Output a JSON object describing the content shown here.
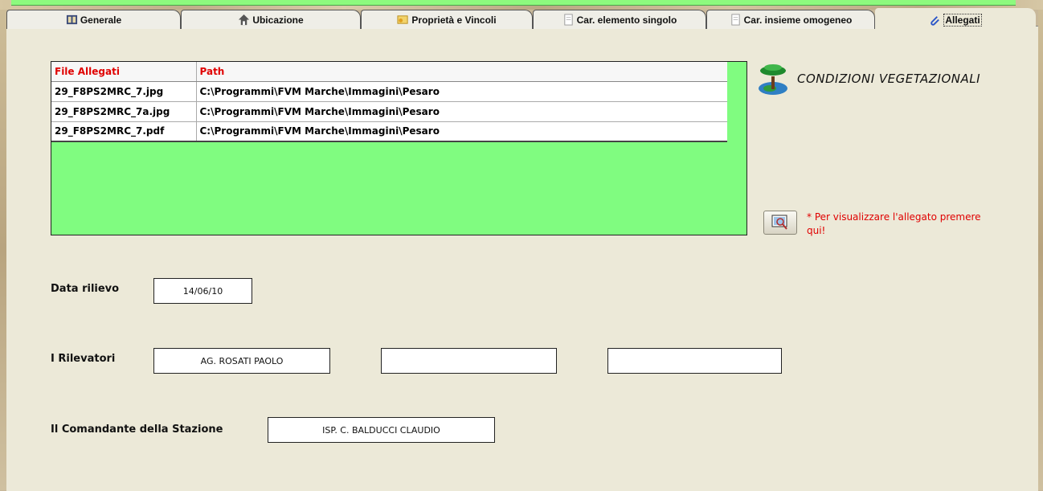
{
  "tabs": [
    {
      "label": "Generale",
      "icon": "book-icon"
    },
    {
      "label": "Ubicazione",
      "icon": "home-icon"
    },
    {
      "label": "Proprietà e Vincoli",
      "icon": "certificate-icon"
    },
    {
      "label": "Car. elemento singolo",
      "icon": "document-icon"
    },
    {
      "label": "Car. insieme omogeneo",
      "icon": "document-icon"
    },
    {
      "label": "Allegati",
      "icon": "paperclip-icon",
      "active": true
    }
  ],
  "attachments": {
    "columns": [
      "File Allegati",
      "Path"
    ],
    "rows": [
      {
        "file": "29_F8PS2MRC_7.jpg",
        "path": "C:\\Programmi\\FVM Marche\\Immagini\\Pesaro"
      },
      {
        "file": "29_F8PS2MRC_7a.jpg",
        "path": "C:\\Programmi\\FVM Marche\\Immagini\\Pesaro"
      },
      {
        "file": "29_F8PS2MRC_7.pdf",
        "path": "C:\\Programmi\\FVM Marche\\Immagini\\Pesaro"
      }
    ]
  },
  "section_title": "CONDIZIONI VEGETAZIONALI",
  "view_note": "* Per visualizzare l'allegato premere qui!",
  "form": {
    "data_rilievo_label": "Data rilievo",
    "data_rilievo_value": "14/06/10",
    "rilevatori_label": "I Rilevatori",
    "rilevatori": [
      "AG. ROSATI PAOLO",
      "",
      ""
    ],
    "comandante_label": "Il Comandante della Stazione",
    "comandante_value": "ISP. C. BALDUCCI CLAUDIO"
  },
  "colors": {
    "grid_bg": "#80fc80",
    "header_text": "#e00000",
    "note_text": "#e00000",
    "panel_bg": "#ece9d8"
  }
}
